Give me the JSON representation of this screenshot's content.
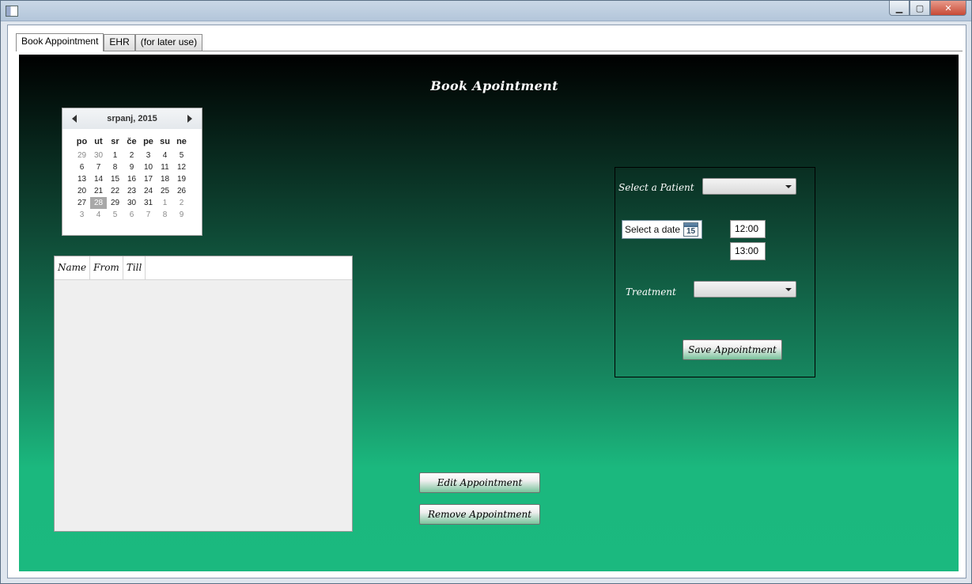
{
  "window": {
    "minimize_label": "▁",
    "maximize_label": "▢",
    "close_label": "✕"
  },
  "tabs": [
    {
      "label": "Book Appointment",
      "active": true
    },
    {
      "label": "EHR",
      "active": false
    },
    {
      "label": "(for later use)",
      "active": false
    }
  ],
  "page": {
    "title": "Book Apointment"
  },
  "calendar": {
    "month_label": "srpanj, 2015",
    "day_headers": [
      "po",
      "ut",
      "sr",
      "če",
      "pe",
      "su",
      "ne"
    ],
    "weeks": [
      [
        "29",
        "30",
        "1",
        "2",
        "3",
        "4",
        "5"
      ],
      [
        "6",
        "7",
        "8",
        "9",
        "10",
        "11",
        "12"
      ],
      [
        "13",
        "14",
        "15",
        "16",
        "17",
        "18",
        "19"
      ],
      [
        "20",
        "21",
        "22",
        "23",
        "24",
        "25",
        "26"
      ],
      [
        "27",
        "28",
        "29",
        "30",
        "31",
        "1",
        "2"
      ],
      [
        "3",
        "4",
        "5",
        "6",
        "7",
        "8",
        "9"
      ]
    ],
    "selected_day": "28",
    "accent_color": "#a8a8a8"
  },
  "appointments_list": {
    "columns": [
      "Name",
      "From",
      "Till"
    ],
    "rows": []
  },
  "actions": {
    "edit_label": "Edit Appointment",
    "remove_label": "Remove Appointment"
  },
  "booking_form": {
    "patient_label": "Select a Patient",
    "patient_value": "",
    "date_placeholder": "Select a date",
    "date_icon_number": "15",
    "time_from": "12:00",
    "time_till": "13:00",
    "treatment_label": "Treatment",
    "treatment_value": "",
    "save_label": "Save Appointment"
  },
  "colors": {
    "panel_gradient_top": "#000000",
    "panel_gradient_bottom": "#1bb97f"
  }
}
